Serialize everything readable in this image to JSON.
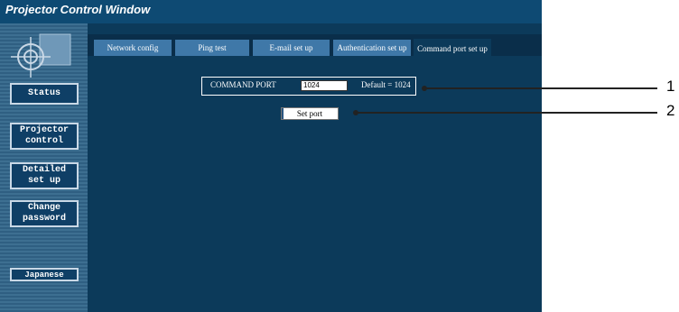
{
  "window": {
    "title": "Projector Control Window"
  },
  "sidebar": {
    "items": [
      {
        "label": "Status"
      },
      {
        "label": "Projector\ncontrol"
      },
      {
        "label": "Detailed\nset up"
      },
      {
        "label": "Change\npassword"
      },
      {
        "label": "Japanese"
      }
    ]
  },
  "tabs": [
    {
      "label": "Network config",
      "active": false
    },
    {
      "label": "Ping test",
      "active": false
    },
    {
      "label": "E-mail set up",
      "active": false
    },
    {
      "label": "Authentication set up",
      "active": false
    },
    {
      "label": "Command port set up",
      "active": true
    }
  ],
  "command_port": {
    "label": "COMMAND PORT",
    "value": "1024",
    "default_text": "Default = 1024",
    "set_button": "Set port"
  },
  "callouts": [
    "1",
    "2"
  ],
  "colors": {
    "background": "#0c3a5a",
    "titlebar": "#0e4a73",
    "tab": "#3f78a8",
    "sidebar": "#3d6f91"
  }
}
